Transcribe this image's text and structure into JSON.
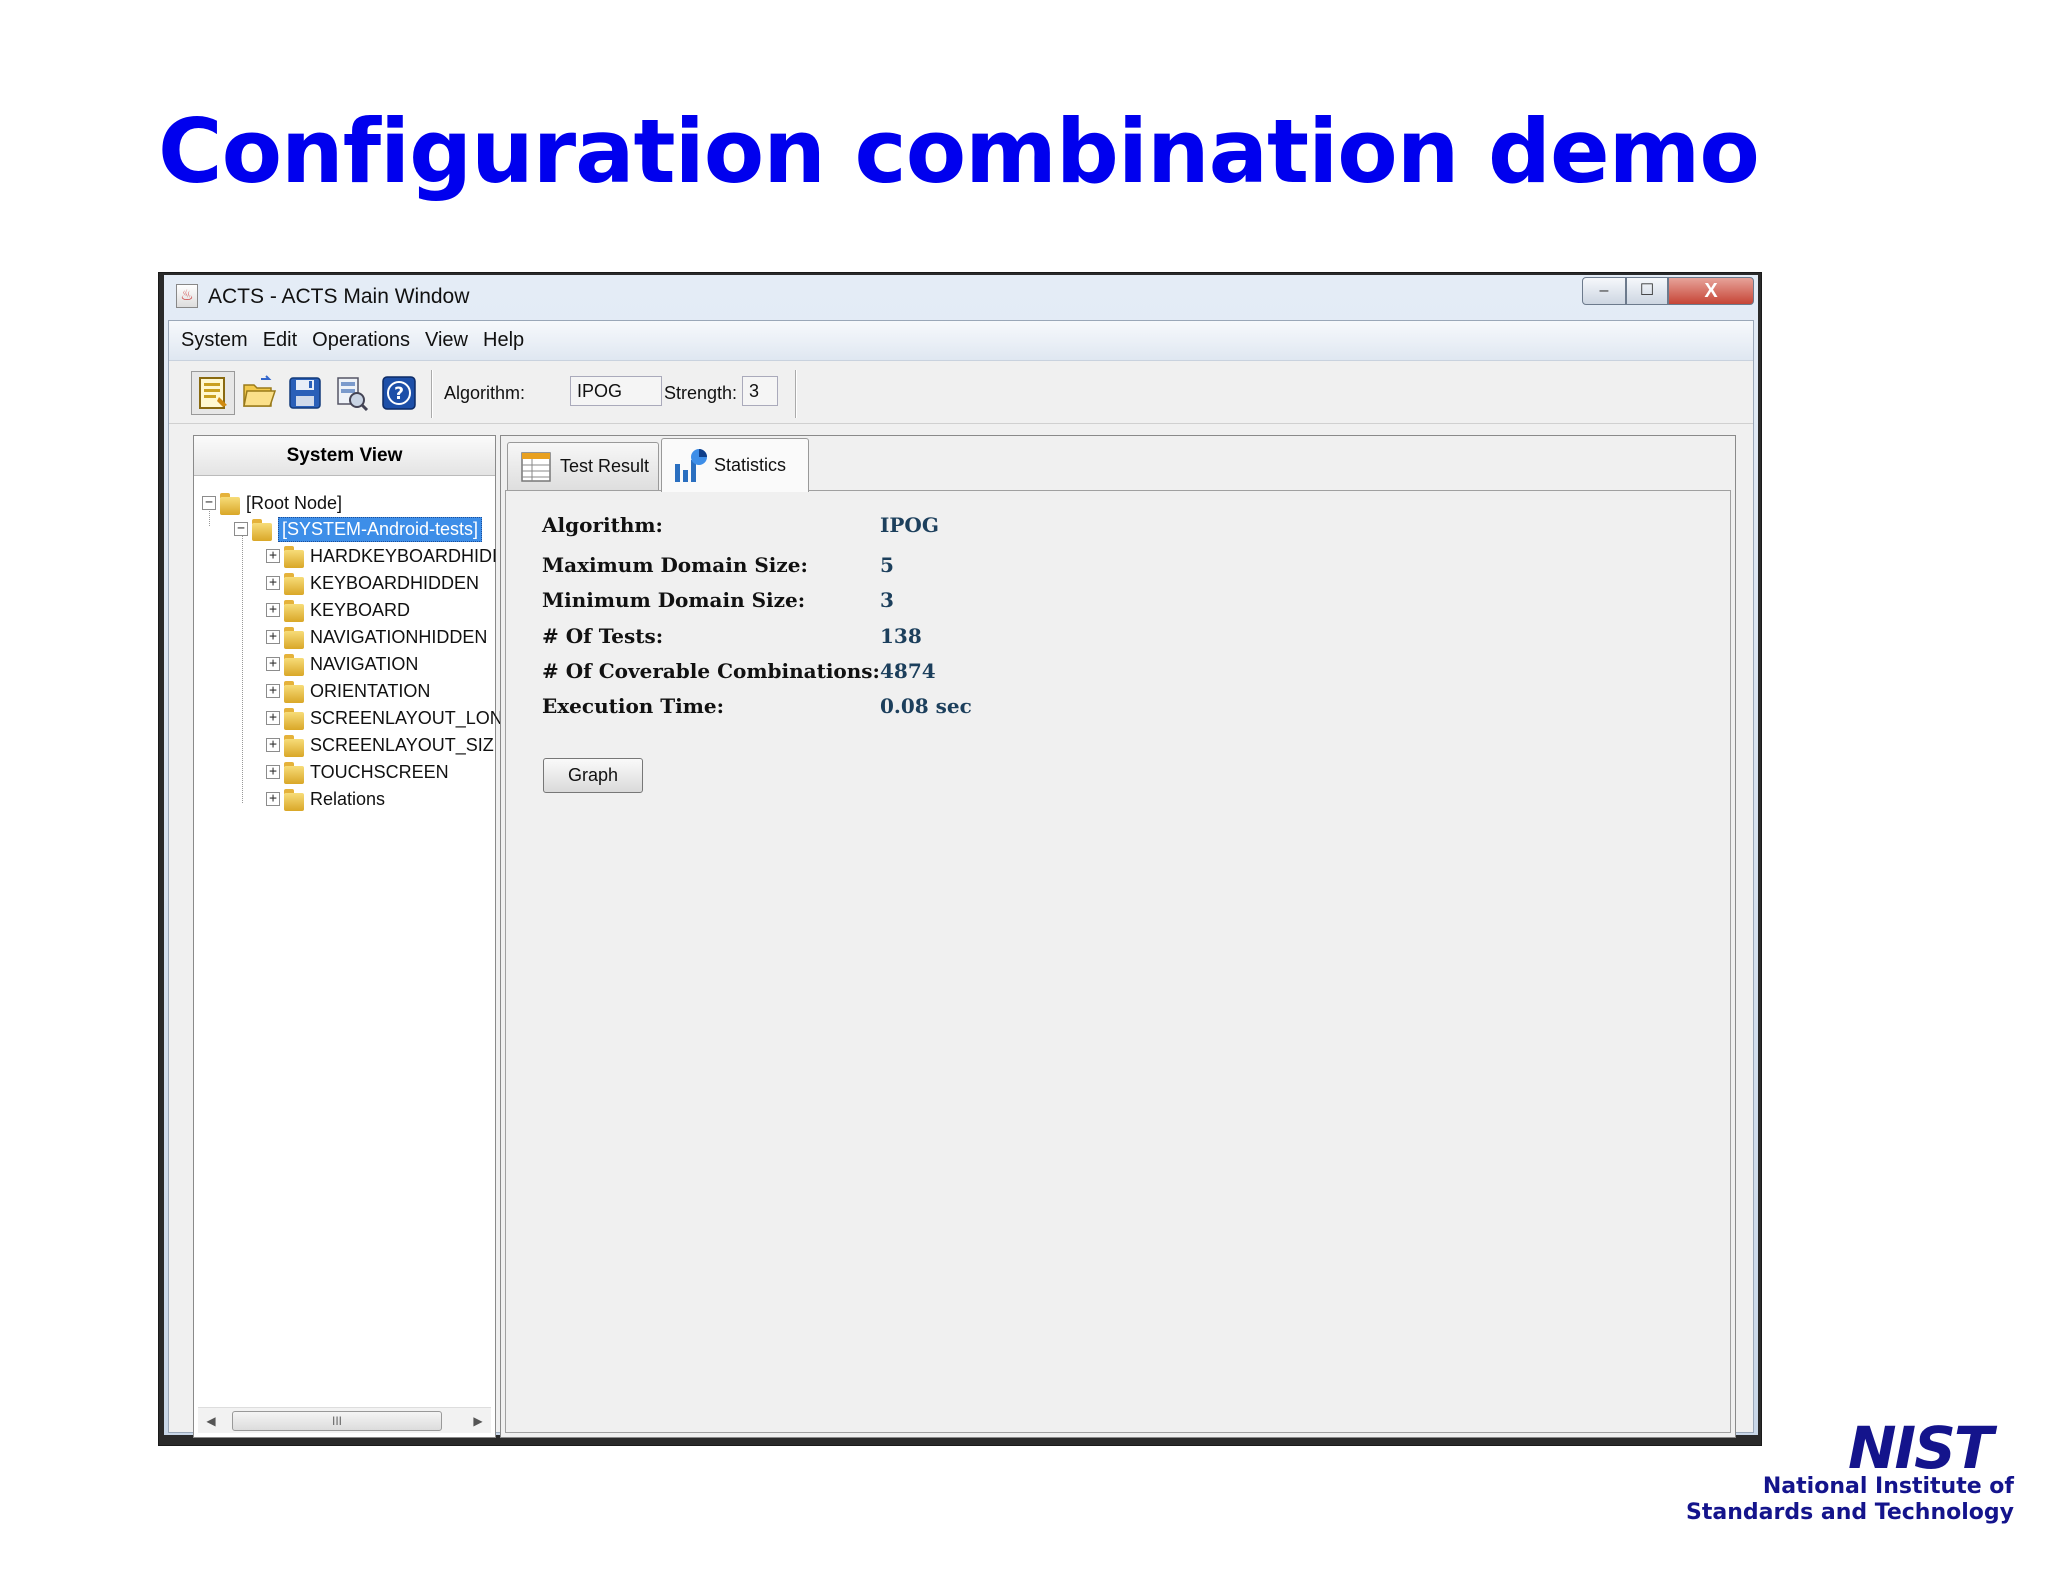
{
  "slide": {
    "title": "Configuration combination demo"
  },
  "window": {
    "title": "ACTS - ACTS Main Window",
    "controls": {
      "minimize": "–",
      "maximize": "☐",
      "close": "X"
    }
  },
  "menu": [
    "System",
    "Edit",
    "Operations",
    "View",
    "Help"
  ],
  "toolbar": {
    "algorithm_label": "Algorithm:",
    "algorithm_value": "IPOG",
    "strength_label": "Strength:",
    "strength_value": "3",
    "icons": [
      "new-system-icon",
      "open-folder-icon",
      "save-icon",
      "build-icon",
      "help-icon"
    ]
  },
  "system_view": {
    "header": "System View",
    "root": "[Root Node]",
    "system": "[SYSTEM-Android-tests]",
    "nodes": [
      "HARDKEYBOARDHIDI",
      "KEYBOARDHIDDEN",
      "KEYBOARD",
      "NAVIGATIONHIDDEN",
      "NAVIGATION",
      "ORIENTATION",
      "SCREENLAYOUT_LON",
      "SCREENLAYOUT_SIZ",
      "TOUCHSCREEN",
      "Relations"
    ],
    "scroll_thumb": "III"
  },
  "tabs": [
    "Test Result",
    "Statistics"
  ],
  "statistics": {
    "rows": [
      {
        "label": "Algorithm:",
        "value": "IPOG"
      },
      {
        "label": "Maximum Domain Size:",
        "value": "5"
      },
      {
        "label": "Minimum Domain Size:",
        "value": "3"
      },
      {
        "label": "# Of Tests:",
        "value": "138"
      },
      {
        "label": "# Of Coverable Combinations:",
        "value": "4874"
      },
      {
        "label": "Execution Time:",
        "value": "0.08 sec"
      }
    ],
    "graph_button": "Graph"
  },
  "logo": {
    "mark": "NIST",
    "line1": "National Institute of",
    "line2": "Standards and Technology"
  }
}
